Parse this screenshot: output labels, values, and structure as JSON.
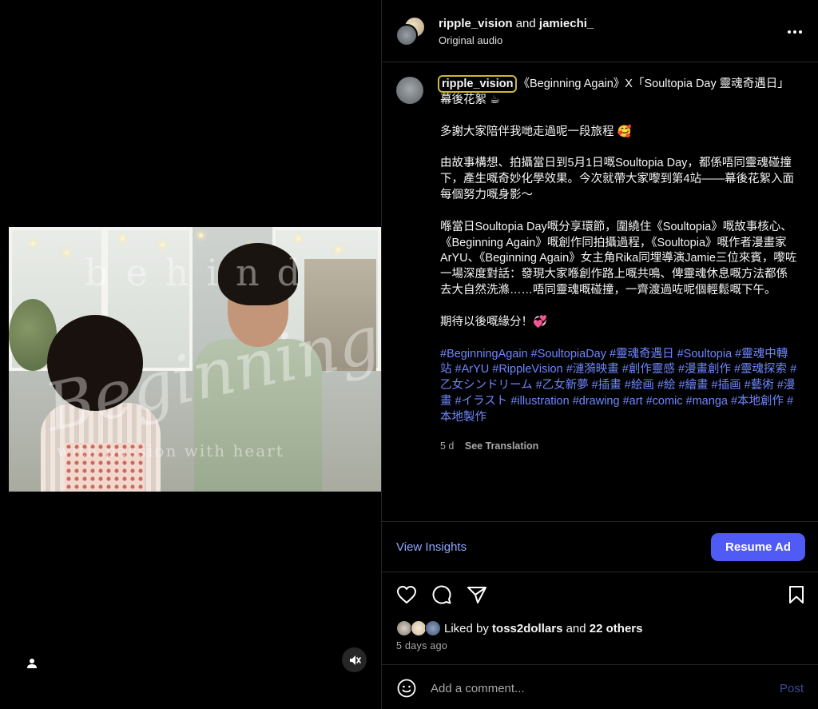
{
  "post": {
    "author": "ripple_vision",
    "collaborator": "jamiechi_",
    "and_word": "and",
    "audio": "Original audio"
  },
  "caption": {
    "username": "ripple_vision",
    "title": "《Beginning Again》X「Soultopia Day 靈魂奇遇日」幕後花絮 ☕",
    "p1": "多謝大家陪伴我哋走過呢一段旅程 🥰",
    "p2": "由故事構想、拍攝當日到5月1日嘅Soultopia Day，都係唔同靈魂碰撞下，產生嘅奇妙化學效果。今次就帶大家嚟到第4站——幕後花絮入面每個努力嘅身影～",
    "p3": "喺當日Soultopia Day嘅分享環節，圍繞住《Soultopia》嘅故事核心、《Beginning Again》嘅創作同拍攝過程，《Soultopia》嘅作者漫畫家ArYU、《Beginning Again》女主角Rika同埋導演Jamie三位來賓，嚟咗一場深度對話：發現大家喺創作路上嘅共鳴、俾靈魂休息嘅方法都係去大自然洗滌……唔同靈魂嘅碰撞，一齊渡過咗呢個輕鬆嘅下午。",
    "p4": "期待以後嘅緣分！💞",
    "hashtags": "#BeginningAgain #SoultopiaDay #靈魂奇遇日 #Soultopia #靈魂中轉站 #ArYU #RippleVision #漣漪映畫 #創作靈感 #漫畫創作 #靈魂探索 #乙女シンドリーム #乙女新夢 #插畫 #絵画 #絵 #繪畫 #插画 #藝術 #漫畫 #イラスト #illustration #drawing #art #comic #manga #本地創作 #本地製作",
    "age": "5 d",
    "see_translation": "See Translation"
  },
  "video_overlay": {
    "behind": "behind",
    "script": "Beginning again",
    "tag": "with passion   with heart"
  },
  "insights": {
    "view_label": "View Insights",
    "resume_label": "Resume Ad"
  },
  "likes": {
    "prefix": "Liked by",
    "user": "toss2dollars",
    "middle": "and",
    "others": "22 others"
  },
  "time_ago": "5 days ago",
  "comment": {
    "placeholder": "Add a comment...",
    "post_label": "Post"
  },
  "colors": {
    "accent": "#4f5bf4",
    "hashtag": "#6e87ff",
    "insights": "#8ea6ff",
    "border": "#262626"
  }
}
